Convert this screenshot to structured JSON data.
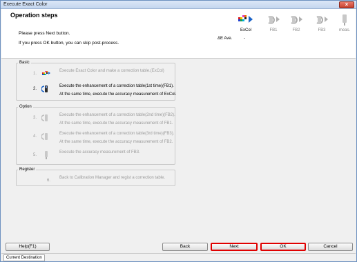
{
  "window": {
    "title": "Execute Exact Color",
    "close_glyph": "×"
  },
  "header": {
    "heading": "Operation steps",
    "message_1": "Please press Next button.",
    "message_2": "If you press OK button, you can skip post-process.",
    "delta_e_label": "ΔE Ave.",
    "delta_e_value": "-"
  },
  "stages": [
    {
      "label": "ExCol",
      "icon": "excol-chart-icon",
      "active": true
    },
    {
      "label": "FB1",
      "icon": "feedback-cycle-icon",
      "active": false
    },
    {
      "label": "FB2",
      "icon": "feedback-cycle-icon",
      "active": false
    },
    {
      "label": "FB3",
      "icon": "feedback-cycle-icon",
      "active": false
    },
    {
      "label": "meas.",
      "icon": "measurement-device-icon",
      "active": false
    }
  ],
  "groups": {
    "basic": {
      "title": "Basic",
      "steps": [
        {
          "num": "1.",
          "line1": "Execute Exact Color and make a correction table.(ExCol)",
          "line2": ""
        },
        {
          "num": "2.",
          "line1": "Execute the enhancement of a correction table(1st time)(FB1).",
          "line2": "At the same time, execute the accuracy measurement of ExCol."
        }
      ]
    },
    "option": {
      "title": "Option",
      "steps": [
        {
          "num": "3.",
          "line1": "Execute the enhancement of a correction table(2nd time)(FB2).",
          "line2": "At the same time, execute the accuracy measurement of FB1."
        },
        {
          "num": "4.",
          "line1": "Execute the enhancement of a correction table(3rd time)(FB3).",
          "line2": "At the same time, execute the accuracy measurement of FB2."
        },
        {
          "num": "5.",
          "line1": "Execute the accuracy measurement of FB3.",
          "line2": ""
        }
      ]
    },
    "register": {
      "title": "Register",
      "steps": [
        {
          "num": "6.",
          "line1": "Back to Calibration Manager and regist a correction table."
        }
      ]
    }
  },
  "buttons": {
    "help": "Help(F1)",
    "back": "Back",
    "next": "Next",
    "ok": "OK",
    "cancel": "Cancel"
  },
  "statusbar": {
    "tab": "Current Destination"
  }
}
